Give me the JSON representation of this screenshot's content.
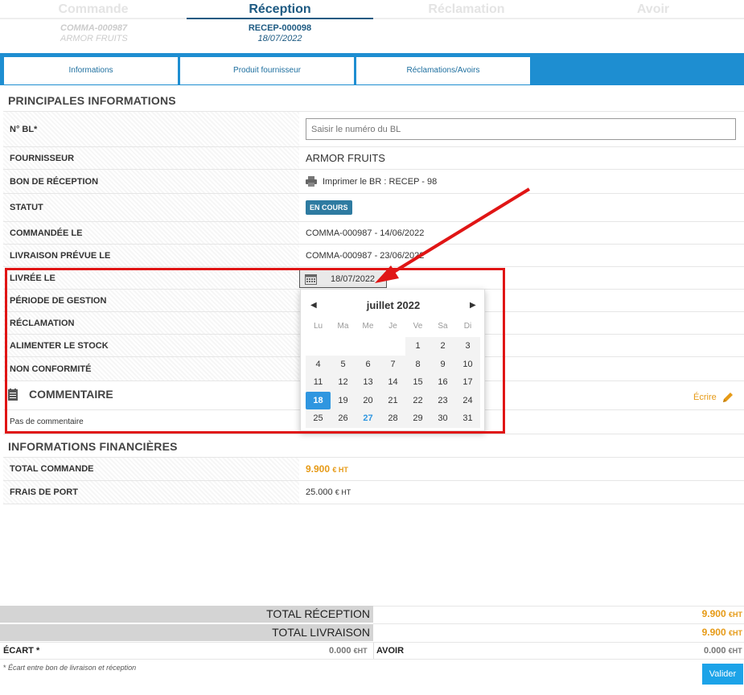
{
  "steps": [
    {
      "title": "Commande",
      "code": "COMMA-000987",
      "sub": "ARMOR FRUITS"
    },
    {
      "title": "Réception",
      "code": "RECEP-000098",
      "sub": "18/07/2022"
    },
    {
      "title": "Réclamation"
    },
    {
      "title": "Avoir"
    }
  ],
  "tabs": [
    "Informations",
    "Produit fournisseur",
    "Réclamations/Avoirs"
  ],
  "main": {
    "section_title": "PRINCIPALES INFORMATIONS",
    "rows": [
      {
        "label": "N° BL*",
        "placeholder": "Saisir le numéro du BL"
      },
      {
        "label": "FOURNISSEUR",
        "value": "ARMOR FRUITS"
      },
      {
        "label": "BON DE RÉCEPTION",
        "value": "Imprimer le BR : RECEP - 98"
      },
      {
        "label": "STATUT",
        "value": "EN COURS"
      },
      {
        "label": "COMMANDÉE LE",
        "value": "COMMA-000987 - 14/06/2022"
      },
      {
        "label": "LIVRAISON PRÉVUE LE",
        "value": "COMMA-000987 - 23/06/2022"
      },
      {
        "label": "LIVRÉE LE",
        "value": "18/07/2022"
      },
      {
        "label": "PÉRIODE DE GESTION"
      },
      {
        "label": "RÉCLAMATION"
      },
      {
        "label": "ALIMENTER LE STOCK"
      },
      {
        "label": "NON CONFORMITÉ"
      }
    ]
  },
  "comment": {
    "title": "COMMENTAIRE",
    "write_label": "Écrire",
    "text": "Pas de commentaire"
  },
  "finance": {
    "title": "INFORMATIONS FINANCIÈRES",
    "total_label": "TOTAL COMMANDE",
    "total_value": "9.900",
    "total_unit": "€ HT",
    "port_label": "FRAIS DE PORT",
    "port_value": "25.000",
    "port_unit": "€ HT"
  },
  "datepicker": {
    "month": "juillet 2022",
    "prev": "◀",
    "next": "▶",
    "dow": [
      "Lu",
      "Ma",
      "Me",
      "Je",
      "Ve",
      "Sa",
      "Di"
    ],
    "weeks": [
      [
        "",
        "",
        "",
        "",
        "1",
        "2",
        "3"
      ],
      [
        "4",
        "5",
        "6",
        "7",
        "8",
        "9",
        "10"
      ],
      [
        "11",
        "12",
        "13",
        "14",
        "15",
        "16",
        "17"
      ],
      [
        "18",
        "19",
        "20",
        "21",
        "22",
        "23",
        "24"
      ],
      [
        "25",
        "26",
        "27",
        "28",
        "29",
        "30",
        "31"
      ]
    ],
    "selected": "18",
    "today": "27"
  },
  "totals": {
    "reception_label": "TOTAL RÉCEPTION",
    "reception_value": "9.900",
    "reception_unit": "€HT",
    "livraison_label": "TOTAL LIVRAISON",
    "livraison_value": "9.900",
    "livraison_unit": "€HT",
    "ecart_label": "ÉCART *",
    "ecart_value": "0.000",
    "ecart_unit": "€HT",
    "avoir_label": "AVOIR",
    "avoir_value": "0.000",
    "avoir_unit": "€HT",
    "footnote_star": "*",
    "footnote": "Écart entre bon de livraison et réception",
    "validate_label": "Valider"
  },
  "colors": {
    "accent": "#1e8ed1",
    "highlight": "#e01515",
    "money": "#e69a16"
  }
}
